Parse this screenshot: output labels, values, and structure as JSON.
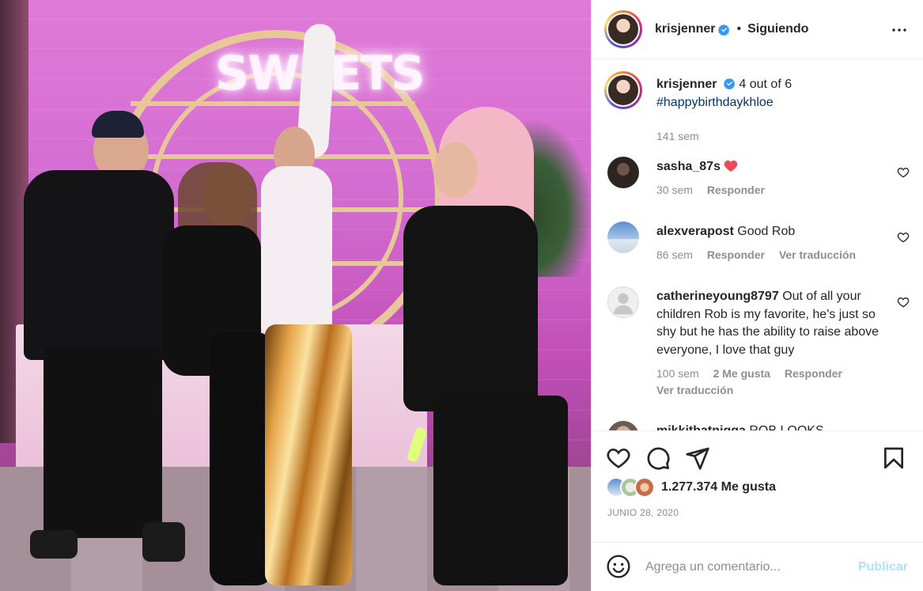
{
  "post": {
    "author": "krisjenner",
    "follow_status": "Siguiendo",
    "photo_sign_text": "SWEETS"
  },
  "caption": {
    "username": "krisjenner",
    "text": "4 out of 6",
    "hashtag": "#happybirthdaykhloe",
    "time": "141 sem"
  },
  "comments": [
    {
      "username": "sasha_87s",
      "text": "",
      "time": "30 sem",
      "likes": "",
      "reply": "Responder",
      "translate": "",
      "avatar_color": "#2b2420"
    },
    {
      "username": "alexverapost",
      "text": "Good Rob",
      "time": "86 sem",
      "likes": "",
      "reply": "Responder",
      "translate": "Ver traducción",
      "avatar_color": "#7fa9d6"
    },
    {
      "username": "catherineyoung8797",
      "text": "Out of all your children Rob is my favorite, he's just so shy but he has the ability to raise above everyone, I love that guy",
      "time": "100 sem",
      "likes": "2 Me gusta",
      "reply": "Responder",
      "translate": "Ver traducción",
      "avatar_color": "#e5e5e5"
    },
    {
      "username": "mikkithatnigga",
      "text": "ROB LOOKS",
      "time": "",
      "likes": "",
      "reply": "",
      "translate": "",
      "avatar_color": "#9c8a78"
    }
  ],
  "actions": {
    "likes_count": "1.277.374 Me gusta",
    "date": "JUNIO 28, 2020"
  },
  "composer": {
    "placeholder": "Agrega un comentario...",
    "publish": "Publicar"
  },
  "colors": {
    "link": "#00376b",
    "verified": "#3897f0",
    "muted": "#8e8e8e",
    "publish_disabled": "#b2dffc",
    "heart_red": "#ed4956"
  },
  "icons": [
    "more-icon",
    "verified-icon",
    "heart-icon",
    "comment-icon",
    "share-icon",
    "bookmark-icon",
    "emoji-icon"
  ]
}
